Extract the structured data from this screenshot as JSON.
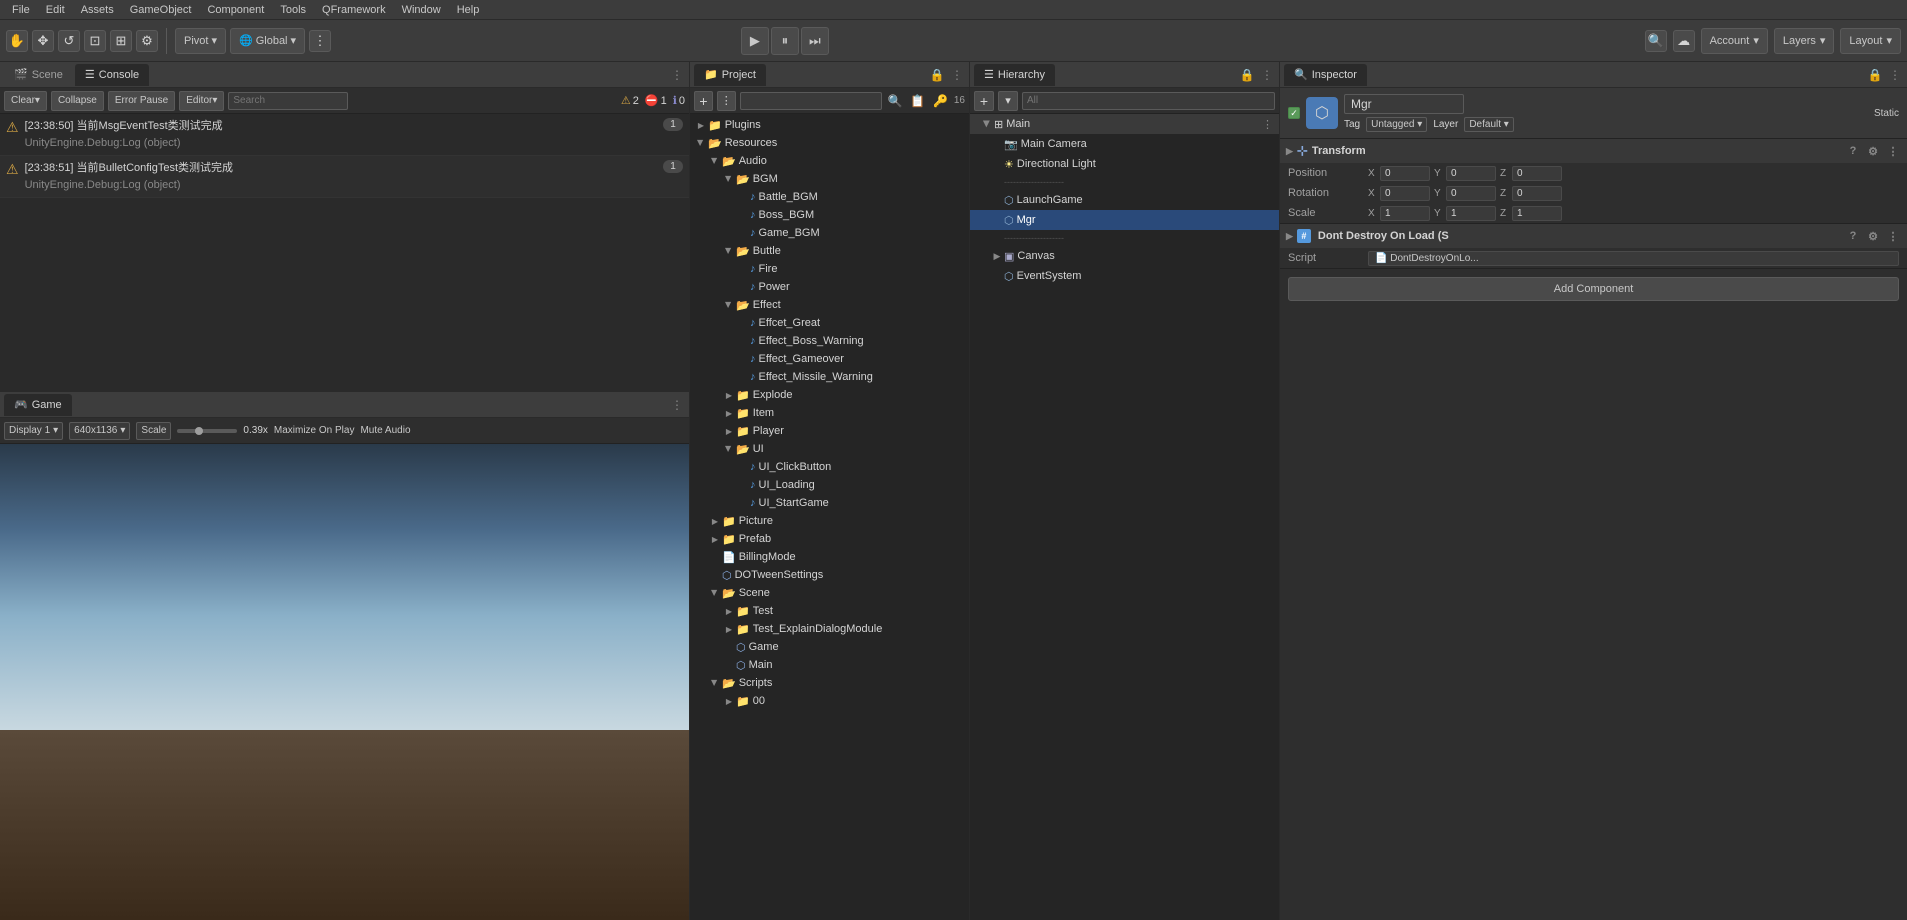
{
  "menu": {
    "items": [
      "File",
      "Edit",
      "Assets",
      "GameObject",
      "Component",
      "Tools",
      "QFramework",
      "Window",
      "Help"
    ]
  },
  "toolbar": {
    "tools": [
      "✋",
      "✥",
      "↺",
      "⊡",
      "⊞",
      "⚙"
    ],
    "pivot_label": "Pivot",
    "global_label": "Global",
    "grid_icon": "⋮⋮",
    "play": "▶",
    "pause": "⏸",
    "step": "⏭",
    "cloud_icon": "☁",
    "search_icon": "🔍",
    "account_label": "Account",
    "layers_label": "Layers",
    "layout_label": "Layout"
  },
  "console": {
    "tab_scene": "Scene",
    "tab_console": "Console",
    "btn_clear": "Clear",
    "btn_collapse": "Collapse",
    "btn_error_pause": "Error Pause",
    "btn_editor": "Editor",
    "search_placeholder": "Search",
    "count_warn": "2",
    "count_alert": "1",
    "count_info": "0",
    "messages": [
      {
        "id": 1,
        "icon": "⚠",
        "icon_color": "#d4a444",
        "text_line1": "[23:38:50] 当前MsgEventTest类测试完成",
        "text_line2": "UnityEngine.Debug:Log (object)",
        "count": "1"
      },
      {
        "id": 2,
        "icon": "⚠",
        "icon_color": "#d4a444",
        "text_line1": "[23:38:51] 当前BulletConfigTest类测试完成",
        "text_line2": "UnityEngine.Debug:Log (object)",
        "count": "1"
      }
    ]
  },
  "game": {
    "tab_label": "Game",
    "display_label": "Display 1",
    "resolution_label": "640x1136",
    "scale_label": "Scale",
    "scale_value": "0.39x",
    "maximize_label": "Maximize On Play",
    "mute_label": "Mute Audio"
  },
  "project": {
    "tab_label": "Project",
    "count_label": "16",
    "tree": [
      {
        "id": "plugins",
        "label": "Plugins",
        "level": 0,
        "type": "folder",
        "open": false
      },
      {
        "id": "resources",
        "label": "Resources",
        "level": 0,
        "type": "folder",
        "open": true
      },
      {
        "id": "audio",
        "label": "Audio",
        "level": 1,
        "type": "folder",
        "open": true
      },
      {
        "id": "bgm",
        "label": "BGM",
        "level": 2,
        "type": "folder",
        "open": true
      },
      {
        "id": "battle_bgm",
        "label": "Battle_BGM",
        "level": 3,
        "type": "audio"
      },
      {
        "id": "boss_bgm",
        "label": "Boss_BGM",
        "level": 3,
        "type": "audio"
      },
      {
        "id": "game_bgm",
        "label": "Game_BGM",
        "level": 3,
        "type": "audio"
      },
      {
        "id": "buttle",
        "label": "Buttle",
        "level": 2,
        "type": "folder",
        "open": true
      },
      {
        "id": "fire",
        "label": "Fire",
        "level": 3,
        "type": "audio"
      },
      {
        "id": "power",
        "label": "Power",
        "level": 3,
        "type": "audio"
      },
      {
        "id": "effect",
        "label": "Effect",
        "level": 2,
        "type": "folder",
        "open": true
      },
      {
        "id": "effect_great",
        "label": "Effcet_Great",
        "level": 3,
        "type": "audio"
      },
      {
        "id": "effect_boss",
        "label": "Effect_Boss_Warning",
        "level": 3,
        "type": "audio"
      },
      {
        "id": "effect_gameover",
        "label": "Effect_Gameover",
        "level": 3,
        "type": "audio"
      },
      {
        "id": "effect_missile",
        "label": "Effect_Missile_Warning",
        "level": 3,
        "type": "audio"
      },
      {
        "id": "explode",
        "label": "Explode",
        "level": 2,
        "type": "folder",
        "open": false
      },
      {
        "id": "item",
        "label": "Item",
        "level": 2,
        "type": "folder",
        "open": false
      },
      {
        "id": "player",
        "label": "Player",
        "level": 2,
        "type": "folder",
        "open": false
      },
      {
        "id": "ui_folder",
        "label": "UI",
        "level": 2,
        "type": "folder",
        "open": true
      },
      {
        "id": "ui_click",
        "label": "UI_ClickButton",
        "level": 3,
        "type": "audio"
      },
      {
        "id": "ui_loading",
        "label": "UI_Loading",
        "level": 3,
        "type": "audio"
      },
      {
        "id": "ui_start",
        "label": "UI_StartGame",
        "level": 3,
        "type": "audio"
      },
      {
        "id": "picture",
        "label": "Picture",
        "level": 1,
        "type": "folder",
        "open": false
      },
      {
        "id": "prefab",
        "label": "Prefab",
        "level": 1,
        "type": "folder",
        "open": false
      },
      {
        "id": "billing",
        "label": "BillingMode",
        "level": 1,
        "type": "file"
      },
      {
        "id": "dotween",
        "label": "DOTweenSettings",
        "level": 1,
        "type": "asset"
      },
      {
        "id": "scene_folder",
        "label": "Scene",
        "level": 1,
        "type": "folder",
        "open": true
      },
      {
        "id": "test",
        "label": "Test",
        "level": 2,
        "type": "folder",
        "open": false
      },
      {
        "id": "test_explain",
        "label": "Test_ExplainDialogModule",
        "level": 2,
        "type": "folder",
        "open": false
      },
      {
        "id": "game_scene",
        "label": "Game",
        "level": 2,
        "type": "scene"
      },
      {
        "id": "main_scene",
        "label": "Main",
        "level": 2,
        "type": "scene"
      },
      {
        "id": "scripts",
        "label": "Scripts",
        "level": 1,
        "type": "folder",
        "open": true
      },
      {
        "id": "scripts_00",
        "label": "00",
        "level": 2,
        "type": "folder",
        "open": false
      }
    ]
  },
  "hierarchy": {
    "tab_label": "Hierarchy",
    "search_placeholder": "All",
    "items": [
      {
        "id": "main_group",
        "label": "Main",
        "level": 0,
        "type": "group",
        "open": true,
        "has_menu": true
      },
      {
        "id": "main_camera",
        "label": "Main Camera",
        "level": 1,
        "type": "camera"
      },
      {
        "id": "dir_light",
        "label": "Directional Light",
        "level": 1,
        "type": "light"
      },
      {
        "id": "sep1",
        "label": "--------------------",
        "level": 1,
        "type": "separator"
      },
      {
        "id": "launch_game",
        "label": "LaunchGame",
        "level": 1,
        "type": "object"
      },
      {
        "id": "mgr",
        "label": "Mgr",
        "level": 1,
        "type": "object",
        "selected": true
      },
      {
        "id": "sep2",
        "label": "--------------------",
        "level": 1,
        "type": "separator"
      },
      {
        "id": "canvas",
        "label": "Canvas",
        "level": 1,
        "type": "canvas",
        "open": false
      },
      {
        "id": "event_system",
        "label": "EventSystem",
        "level": 1,
        "type": "object"
      }
    ]
  },
  "inspector": {
    "tab_label": "Inspector",
    "object_name": "Mgr",
    "static_label": "Static",
    "tag_label": "Tag",
    "tag_value": "Untagged",
    "layer_label": "Layer",
    "layer_value": "Default",
    "transform": {
      "title": "Transform",
      "position_label": "Position",
      "pos_x": "0",
      "pos_y": "0",
      "pos_z": "0",
      "rotation_label": "Rotation",
      "rot_x": "0",
      "rot_y": "0",
      "rot_z": "0",
      "scale_label": "Scale",
      "scale_x": "1",
      "scale_y": "1",
      "scale_z": "1"
    },
    "dont_destroy": {
      "title": "Dont Destroy On Load (S",
      "script_label": "Script",
      "script_value": "DontDestroyOnLo..."
    },
    "add_component_label": "Add Component"
  }
}
